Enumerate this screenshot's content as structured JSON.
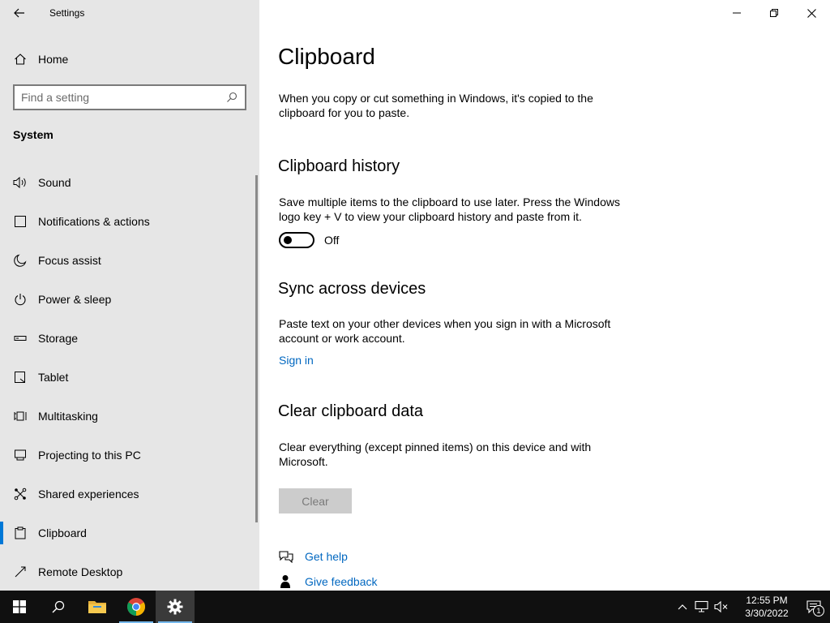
{
  "window": {
    "title": "Settings"
  },
  "sidebar": {
    "home_label": "Home",
    "search": {
      "placeholder": "Find a setting"
    },
    "section_title": "System",
    "items": [
      {
        "label": "Sound",
        "icon": "speaker-icon"
      },
      {
        "label": "Notifications & actions",
        "icon": "notifications-icon"
      },
      {
        "label": "Focus assist",
        "icon": "moon-icon"
      },
      {
        "label": "Power & sleep",
        "icon": "power-icon"
      },
      {
        "label": "Storage",
        "icon": "storage-icon"
      },
      {
        "label": "Tablet",
        "icon": "tablet-icon"
      },
      {
        "label": "Multitasking",
        "icon": "multitasking-icon"
      },
      {
        "label": "Projecting to this PC",
        "icon": "projecting-icon"
      },
      {
        "label": "Shared experiences",
        "icon": "shared-experiences-icon"
      },
      {
        "label": "Clipboard",
        "icon": "clipboard-icon",
        "active": true
      },
      {
        "label": "Remote Desktop",
        "icon": "remote-desktop-icon"
      }
    ]
  },
  "main": {
    "title": "Clipboard",
    "intro": "When you copy or cut something in Windows, it's copied to the clipboard for you to paste.",
    "history": {
      "heading": "Clipboard history",
      "description": "Save multiple items to the clipboard to use later. Press the Windows logo key + V to view your clipboard history and paste from it.",
      "toggle_state": "Off"
    },
    "sync": {
      "heading": "Sync across devices",
      "description": "Paste text on your other devices when you sign in with a Microsoft account or work account.",
      "link": "Sign in"
    },
    "clear": {
      "heading": "Clear clipboard data",
      "description": "Clear everything (except pinned items) on this device and with Microsoft.",
      "button": "Clear"
    },
    "help": {
      "get_help": "Get help",
      "give_feedback": "Give feedback"
    }
  },
  "taskbar": {
    "clock_time": "12:55 PM",
    "clock_date": "3/30/2022",
    "notification_count": "1"
  },
  "colors": {
    "accent": "#0078d7",
    "link": "#0067c0",
    "sidebar_bg": "#e6e6e6",
    "taskbar_bg": "#101010"
  }
}
